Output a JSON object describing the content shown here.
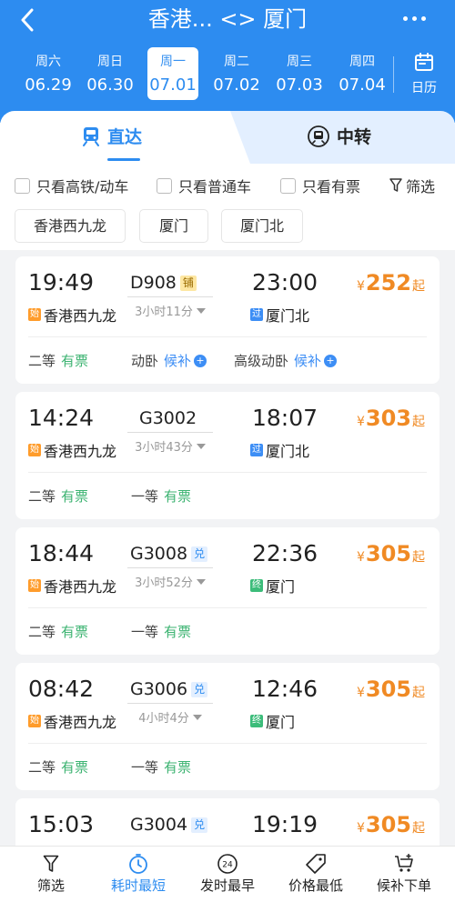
{
  "header": {
    "title": "香港... <> 厦门",
    "brand_color": "#2d8cf0"
  },
  "dates": [
    {
      "weekday": "周六",
      "date": "06.29",
      "active": false
    },
    {
      "weekday": "周日",
      "date": "06.30",
      "active": false
    },
    {
      "weekday": "周一",
      "date": "07.01",
      "active": true
    },
    {
      "weekday": "周二",
      "date": "07.02",
      "active": false
    },
    {
      "weekday": "周三",
      "date": "07.03",
      "active": false
    },
    {
      "weekday": "周四",
      "date": "07.04",
      "active": false
    }
  ],
  "calendar_label": "日历",
  "tabs": {
    "direct": "直达",
    "transfer": "中转"
  },
  "filters": {
    "high_speed": "只看高铁/动车",
    "normal": "只看普通车",
    "available": "只看有票",
    "filter": "筛选"
  },
  "stations": [
    "香港西九龙",
    "厦门",
    "厦门北"
  ],
  "trains": [
    {
      "dep_time": "19:49",
      "train_no": "D908",
      "badge": "铺",
      "badge_type": "berth",
      "arr_time": "23:00",
      "price_prefix": "¥",
      "price": "252",
      "price_suffix": "起",
      "duration": "3小时11分",
      "dep_tag": "始",
      "dep_station": "香港西九龙",
      "arr_tag": "过",
      "arr_tag_type": "pass",
      "arr_station": "厦门北",
      "seats": [
        {
          "class": "二等",
          "status": "有票",
          "kind": "ok"
        },
        {
          "class": "动卧",
          "status": "候补",
          "kind": "wait"
        },
        {
          "class": "高级动卧",
          "status": "候补",
          "kind": "wait"
        }
      ]
    },
    {
      "dep_time": "14:24",
      "train_no": "G3002",
      "badge": "",
      "badge_type": "",
      "arr_time": "18:07",
      "price_prefix": "¥",
      "price": "303",
      "price_suffix": "起",
      "duration": "3小时43分",
      "dep_tag": "始",
      "dep_station": "香港西九龙",
      "arr_tag": "过",
      "arr_tag_type": "pass",
      "arr_station": "厦门北",
      "seats": [
        {
          "class": "二等",
          "status": "有票",
          "kind": "ok"
        },
        {
          "class": "一等",
          "status": "有票",
          "kind": "ok"
        }
      ]
    },
    {
      "dep_time": "18:44",
      "train_no": "G3008",
      "badge": "兑",
      "badge_type": "exchange",
      "arr_time": "22:36",
      "price_prefix": "¥",
      "price": "305",
      "price_suffix": "起",
      "duration": "3小时52分",
      "dep_tag": "始",
      "dep_station": "香港西九龙",
      "arr_tag": "终",
      "arr_tag_type": "end",
      "arr_station": "厦门",
      "seats": [
        {
          "class": "二等",
          "status": "有票",
          "kind": "ok"
        },
        {
          "class": "一等",
          "status": "有票",
          "kind": "ok"
        }
      ]
    },
    {
      "dep_time": "08:42",
      "train_no": "G3006",
      "badge": "兑",
      "badge_type": "exchange",
      "arr_time": "12:46",
      "price_prefix": "¥",
      "price": "305",
      "price_suffix": "起",
      "duration": "4小时4分",
      "dep_tag": "始",
      "dep_station": "香港西九龙",
      "arr_tag": "终",
      "arr_tag_type": "end",
      "arr_station": "厦门",
      "seats": [
        {
          "class": "二等",
          "status": "有票",
          "kind": "ok"
        },
        {
          "class": "一等",
          "status": "有票",
          "kind": "ok"
        }
      ]
    },
    {
      "dep_time": "15:03",
      "train_no": "G3004",
      "badge": "兑",
      "badge_type": "exchange",
      "arr_time": "19:19",
      "price_prefix": "¥",
      "price": "305",
      "price_suffix": "起",
      "duration": "",
      "dep_tag": "",
      "dep_station": "",
      "arr_tag": "",
      "arr_tag_type": "",
      "arr_station": "",
      "seats": []
    }
  ],
  "bottom_nav": [
    {
      "label": "筛选",
      "icon": "funnel-icon",
      "active": false
    },
    {
      "label": "耗时最短",
      "icon": "stopwatch-icon",
      "active": true
    },
    {
      "label": "发时最早",
      "icon": "clock-24-icon",
      "active": false
    },
    {
      "label": "价格最低",
      "icon": "price-tag-icon",
      "active": false
    },
    {
      "label": "候补下单",
      "icon": "cart-add-icon",
      "active": false
    }
  ]
}
